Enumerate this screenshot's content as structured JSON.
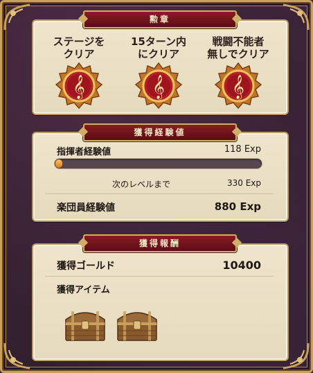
{
  "sections": {
    "medals_title": "勲章",
    "exp_title": "獲得経験値",
    "reward_title": "獲得報酬"
  },
  "medals": [
    {
      "label": "ステージを\nクリア",
      "icon": "treble-clef-medal-icon"
    },
    {
      "label": "15ターン内\nにクリア",
      "icon": "treble-clef-medal-icon"
    },
    {
      "label": "戦闘不能者\n無しでクリア",
      "icon": "treble-clef-medal-icon"
    }
  ],
  "exp": {
    "commander_label": "指揮者経験値",
    "commander_value": "118 Exp",
    "progress_fraction": 0.02,
    "next_level_label": "次のレベルまで",
    "next_level_value": "330 Exp",
    "band_label": "楽団員経験値",
    "band_value": "880 Exp"
  },
  "rewards": {
    "gold_label": "獲得ゴールド",
    "gold_value": "10400",
    "items_label": "獲得アイテム",
    "items": [
      "treasure-chest-icon",
      "treasure-chest-icon"
    ]
  },
  "colors": {
    "banner": "#7a1820",
    "panel": "#ebe0c5",
    "frame_gold": "#c9a15a",
    "bar_fill": "#f0a040"
  }
}
